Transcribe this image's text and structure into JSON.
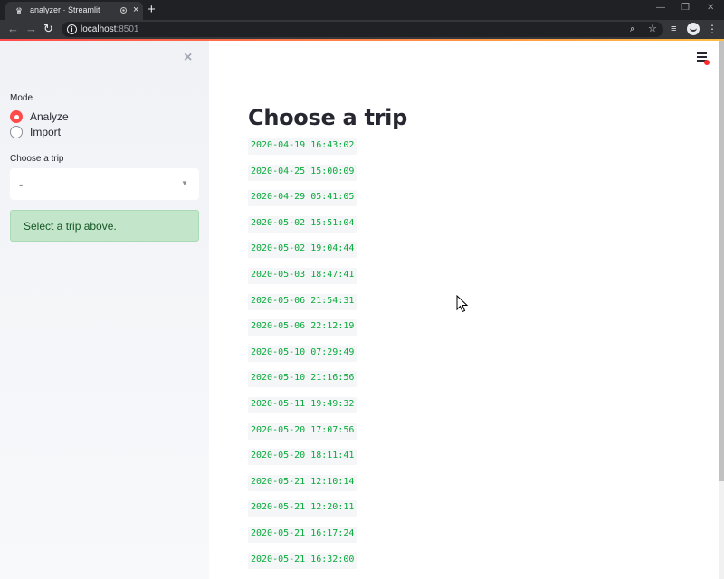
{
  "browser": {
    "tab_title": "analyzer · Streamlit",
    "tab_close": "×",
    "new_tab": "+",
    "url_host": "localhost",
    "url_port": ":8501",
    "window_controls": [
      "—",
      "❐",
      "✕"
    ],
    "toolbar_icons": [
      "search-icon",
      "star-icon",
      "media-icon",
      "avatar",
      "kebab-menu-icon"
    ]
  },
  "sidebar": {
    "close_icon": "×",
    "mode_label": "Mode",
    "mode_options": [
      {
        "label": "Analyze",
        "checked": true
      },
      {
        "label": "Import",
        "checked": false
      }
    ],
    "trip_label": "Choose a trip",
    "trip_select_value": "-",
    "info_message": "Select a trip above."
  },
  "main": {
    "title": "Choose a trip",
    "trips": [
      "2020-04-19 16:43:02",
      "2020-04-25 15:00:09",
      "2020-04-29 05:41:05",
      "2020-05-02 15:51:04",
      "2020-05-02 19:04:44",
      "2020-05-03 18:47:41",
      "2020-05-06 21:54:31",
      "2020-05-06 22:12:19",
      "2020-05-10 07:29:49",
      "2020-05-10 21:16:56",
      "2020-05-11 19:49:32",
      "2020-05-20 17:07:56",
      "2020-05-20 18:11:41",
      "2020-05-21 12:10:14",
      "2020-05-21 12:20:11",
      "2020-05-21 16:17:24",
      "2020-05-21 16:32:00"
    ]
  },
  "colors": {
    "accent": "#ff4b4b",
    "trip_text": "#09ab3b",
    "alert_bg": "#c3e6cb",
    "alert_text": "#155724",
    "sidebar_bg": "#f0f2f6"
  }
}
